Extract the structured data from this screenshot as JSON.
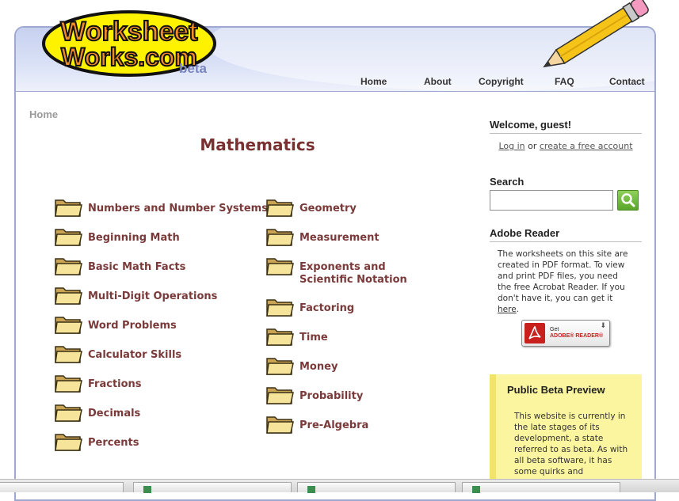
{
  "logo": {
    "line1": "Worksheet",
    "line2": "Works.com",
    "beta": "beta"
  },
  "topnav": [
    {
      "label": "Home"
    },
    {
      "label": "About"
    },
    {
      "label": "Copyright"
    },
    {
      "label": "FAQ"
    },
    {
      "label": "Contact"
    }
  ],
  "breadcrumb": "Home",
  "page_title": "Mathematics",
  "categories_left": [
    {
      "label": "Numbers and Number Systems"
    },
    {
      "label": "Beginning Math"
    },
    {
      "label": "Basic Math Facts"
    },
    {
      "label": "Multi-Digit Operations"
    },
    {
      "label": "Word Problems"
    },
    {
      "label": "Calculator Skills"
    },
    {
      "label": "Fractions"
    },
    {
      "label": "Decimals"
    },
    {
      "label": "Percents"
    }
  ],
  "categories_right": [
    {
      "label": "Geometry"
    },
    {
      "label": "Measurement"
    },
    {
      "label": "Exponents and Scientific Notation"
    },
    {
      "label": "Factoring"
    },
    {
      "label": "Time"
    },
    {
      "label": "Money"
    },
    {
      "label": "Probability"
    },
    {
      "label": "Pre-Algebra"
    }
  ],
  "sidebar": {
    "welcome": "Welcome, guest!",
    "login_link": "Log in",
    "or_text": "or",
    "create_account_link": "create a free account",
    "search_heading": "Search",
    "search_value": "",
    "reader_heading": "Adobe Reader",
    "reader_text": "The worksheets on this site are created in PDF format. To view and print PDF files, you need the free Acrobat Reader. If you don't have it, you can get it",
    "reader_here_link": "here",
    "reader_badge_get": "Get",
    "reader_badge_brand": "ADOBE® READER®",
    "beta_title": "Public Beta Preview",
    "beta_text": "This website is currently in the late stages of its development, a state referred to as beta. As with all beta software, it has some quirks and"
  },
  "colors": {
    "title": "#7a3030",
    "category_text": "#7a3a3a",
    "header_band": "#d9e0f6",
    "beta_box": "#fbf5a0",
    "search_button": "#5aa62a"
  },
  "icons": {
    "folder": "folder-icon",
    "search": "magnifier-icon",
    "pencil": "pencil-icon",
    "pdf": "adobe-pdf-icon"
  }
}
